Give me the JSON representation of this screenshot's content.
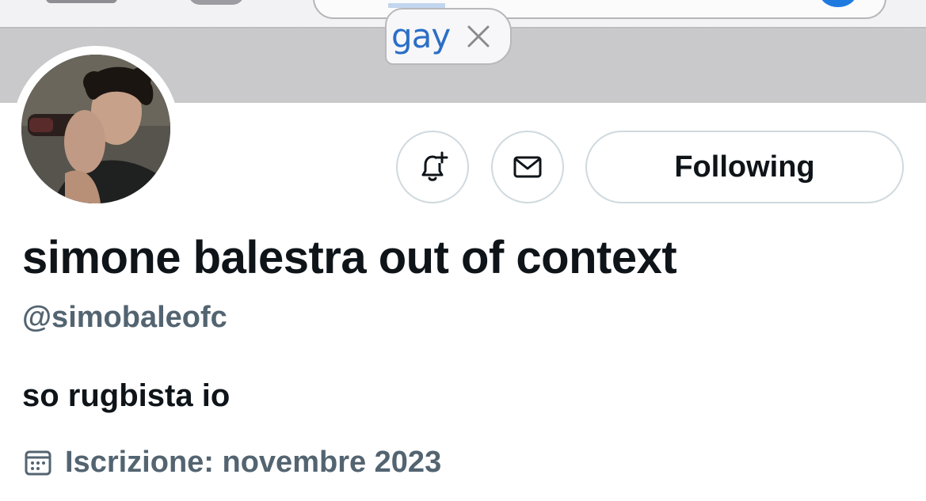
{
  "banner": {
    "search_token": "gay"
  },
  "profile": {
    "display_name": "simone balestra out of context",
    "handle": "@simobaleofc",
    "bio": "so rugbista io",
    "joined": "Iscrizione: novembre 2023"
  },
  "actions": {
    "following_label": "Following"
  },
  "icons": {
    "notify": "bell-plus-icon",
    "message": "envelope-icon",
    "calendar": "calendar-icon",
    "remove_token": "close-icon"
  },
  "colors": {
    "text_primary": "#0f1419",
    "text_secondary": "#536471",
    "border": "#cfd9de",
    "token_text": "#2b6fc6"
  }
}
